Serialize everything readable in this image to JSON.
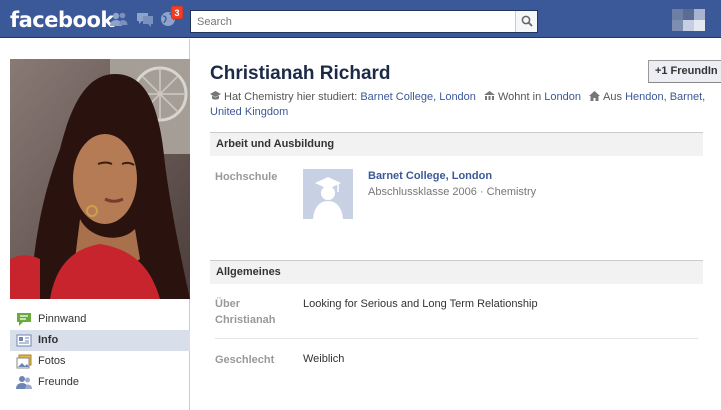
{
  "header": {
    "logo": "facebook",
    "notification_count": "3",
    "search_placeholder": "Search",
    "colors": {
      "bar": "#3b5998",
      "badge": "#f03d25"
    }
  },
  "nav": {
    "items": [
      {
        "label": "Pinnwand",
        "icon": "wall-icon"
      },
      {
        "label": "Info",
        "icon": "info-icon",
        "active": true
      },
      {
        "label": "Fotos",
        "icon": "photos-icon"
      },
      {
        "label": "Freunde",
        "icon": "friends-icon"
      }
    ]
  },
  "profile": {
    "name": "Christianah Richard",
    "add_friend_label": "FreundIn",
    "facts": {
      "study_prefix": "Hat Chemistry hier studiert:",
      "study_link": "Barnet College, London",
      "lives_prefix": "Wohnt in",
      "lives_link": "London",
      "from_prefix": "Aus",
      "from_link": "Hendon, Barnet, United Kingdom"
    }
  },
  "work_education": {
    "heading": "Arbeit und Ausbildung",
    "label": "Hochschule",
    "school_name": "Barnet College, London",
    "school_year": "Abschlussklasse 2006",
    "school_dot": "·",
    "school_field": "Chemistry"
  },
  "general": {
    "heading": "Allgemeines",
    "about_label_line1": "Über",
    "about_label_line2": "Christianah",
    "about_value": "Looking for Serious and Long Term Relationship",
    "gender_label": "Geschlecht",
    "gender_value": "Weiblich"
  }
}
